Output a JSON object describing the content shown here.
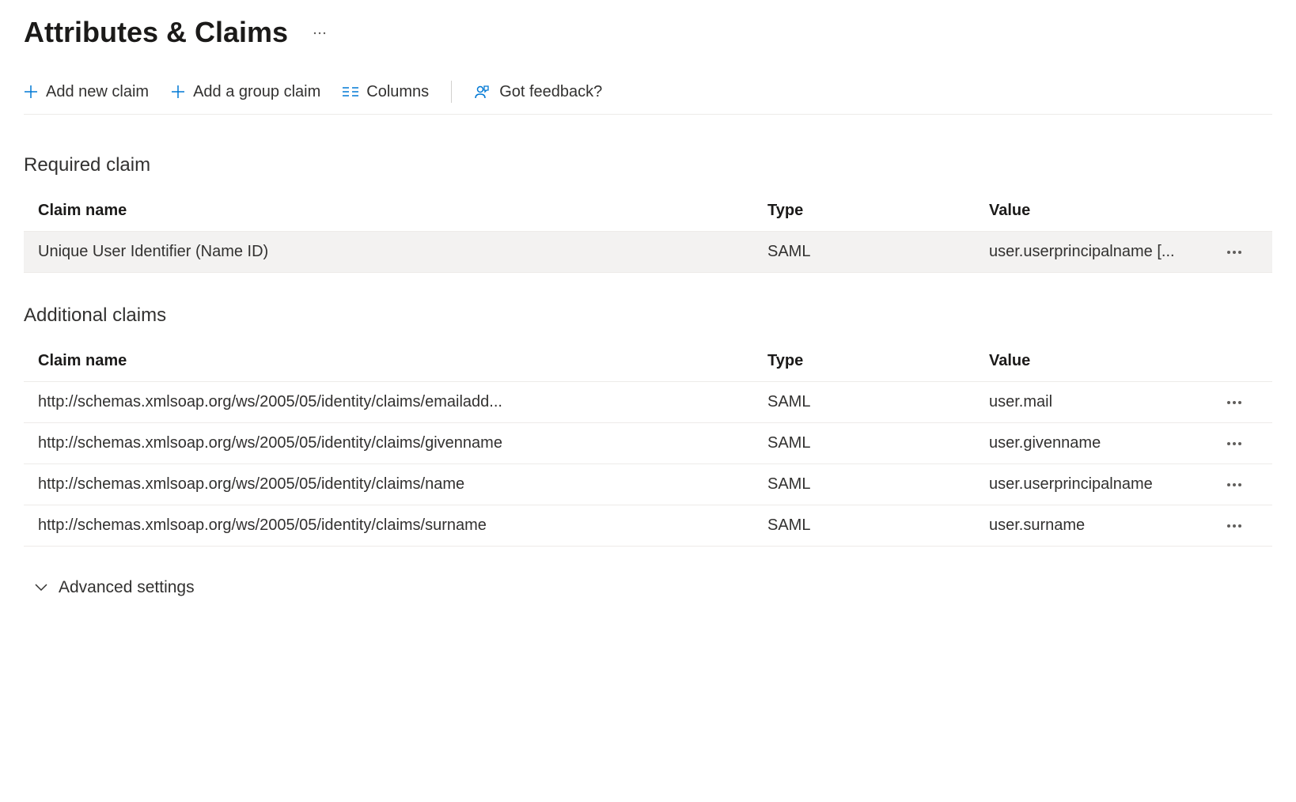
{
  "header": {
    "title": "Attributes & Claims"
  },
  "toolbar": {
    "add_new_claim": "Add new claim",
    "add_group_claim": "Add a group claim",
    "columns": "Columns",
    "feedback": "Got feedback?"
  },
  "required_section": {
    "title": "Required claim",
    "columns": {
      "name": "Claim name",
      "type": "Type",
      "value": "Value"
    },
    "rows": [
      {
        "name": "Unique User Identifier (Name ID)",
        "type": "SAML",
        "value": "user.userprincipalname [..."
      }
    ]
  },
  "additional_section": {
    "title": "Additional claims",
    "columns": {
      "name": "Claim name",
      "type": "Type",
      "value": "Value"
    },
    "rows": [
      {
        "name": "http://schemas.xmlsoap.org/ws/2005/05/identity/claims/emailadd...",
        "type": "SAML",
        "value": "user.mail"
      },
      {
        "name": "http://schemas.xmlsoap.org/ws/2005/05/identity/claims/givenname",
        "type": "SAML",
        "value": "user.givenname"
      },
      {
        "name": "http://schemas.xmlsoap.org/ws/2005/05/identity/claims/name",
        "type": "SAML",
        "value": "user.userprincipalname"
      },
      {
        "name": "http://schemas.xmlsoap.org/ws/2005/05/identity/claims/surname",
        "type": "SAML",
        "value": "user.surname"
      }
    ]
  },
  "advanced": {
    "label": "Advanced settings"
  }
}
